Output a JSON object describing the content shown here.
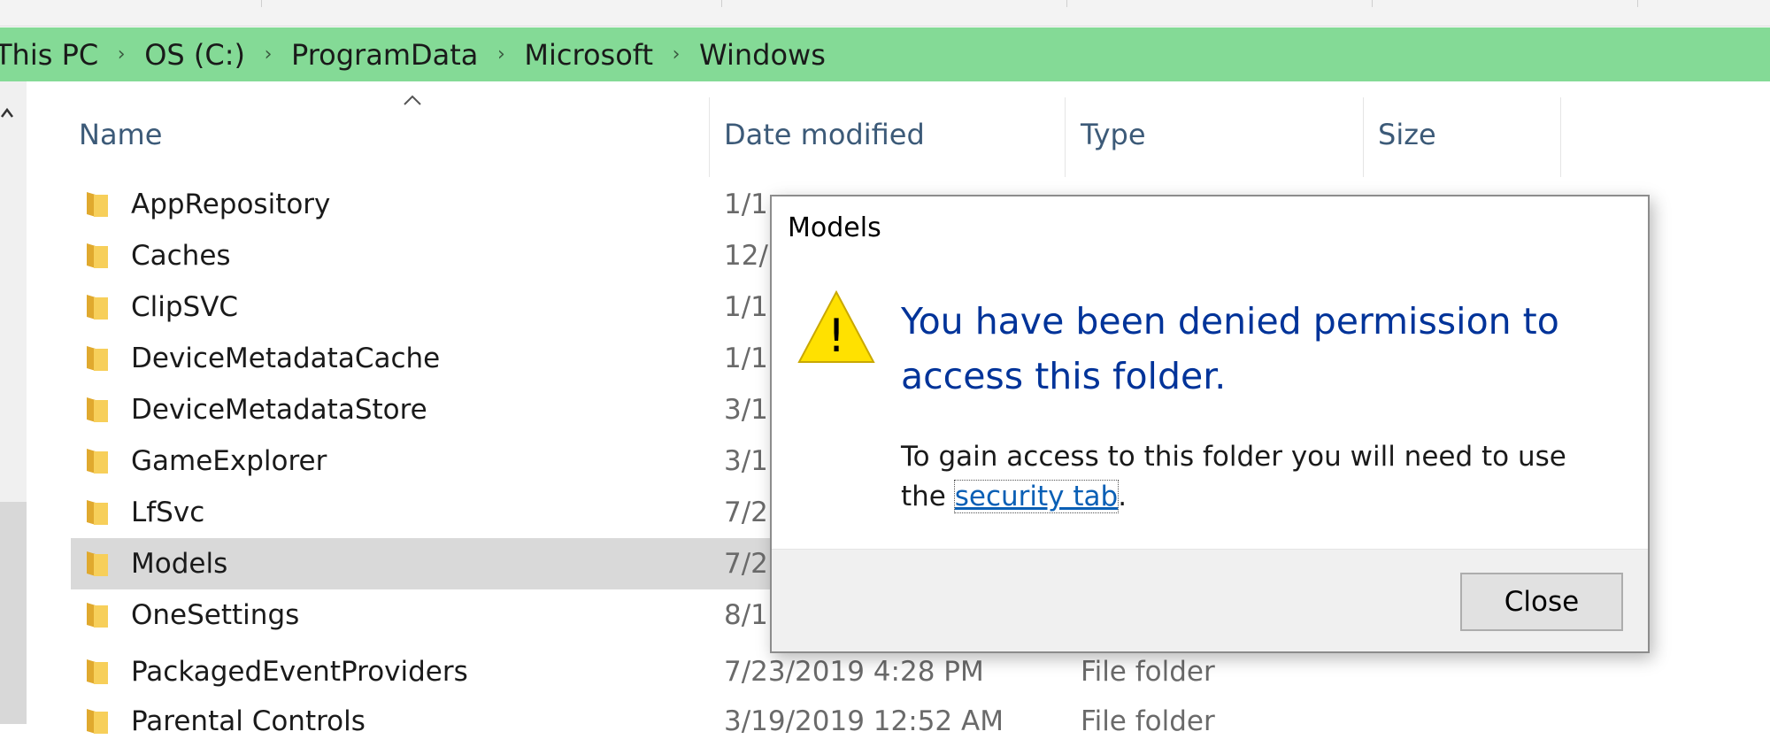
{
  "address_bar": {
    "crumbs": [
      "This PC",
      "OS (C:)",
      "ProgramData",
      "Microsoft",
      "Windows"
    ],
    "chevron": "›"
  },
  "columns": {
    "name": "Name",
    "date": "Date modified",
    "type": "Type",
    "size": "Size"
  },
  "rows": [
    {
      "name": "AppRepository",
      "date": "1/1",
      "type": ""
    },
    {
      "name": "Caches",
      "date": "12/",
      "type": ""
    },
    {
      "name": "ClipSVC",
      "date": "1/1",
      "type": ""
    },
    {
      "name": "DeviceMetadataCache",
      "date": "1/1",
      "type": ""
    },
    {
      "name": "DeviceMetadataStore",
      "date": "3/1",
      "type": ""
    },
    {
      "name": "GameExplorer",
      "date": "3/1",
      "type": ""
    },
    {
      "name": "LfSvc",
      "date": "7/2",
      "type": ""
    },
    {
      "name": "Models",
      "date": "7/2",
      "type": "",
      "selected": true
    },
    {
      "name": "OneSettings",
      "date": "8/1",
      "type": ""
    },
    {
      "name": "PackagedEventProviders",
      "date": "7/23/2019 4:28 PM",
      "type": "File folder"
    },
    {
      "name": "Parental Controls",
      "date": "3/19/2019 12:52 AM",
      "type": "File folder"
    }
  ],
  "dialog": {
    "title": "Models",
    "main_message": "You have been denied permission to access this folder.",
    "sub_message_prefix": "To gain access to this folder you will need to use the",
    "link_text": "security tab",
    "sub_message_suffix": ".",
    "close_label": "Close",
    "warning_glyph": "!"
  },
  "colors": {
    "address_bar": "#84da96",
    "header_text": "#3c5a78",
    "dialog_heading": "#003399",
    "link": "#0a5fb5",
    "warning_fill": "#ffe100",
    "folder": "#f7cf5a",
    "selection": "#d9d9d9"
  },
  "icons": {
    "folder": "folder-icon",
    "warning": "warning-icon",
    "crumb_separator": "chevron-right-icon",
    "sort": "sort-ascending-icon",
    "scroll_up": "scroll-up-icon"
  }
}
